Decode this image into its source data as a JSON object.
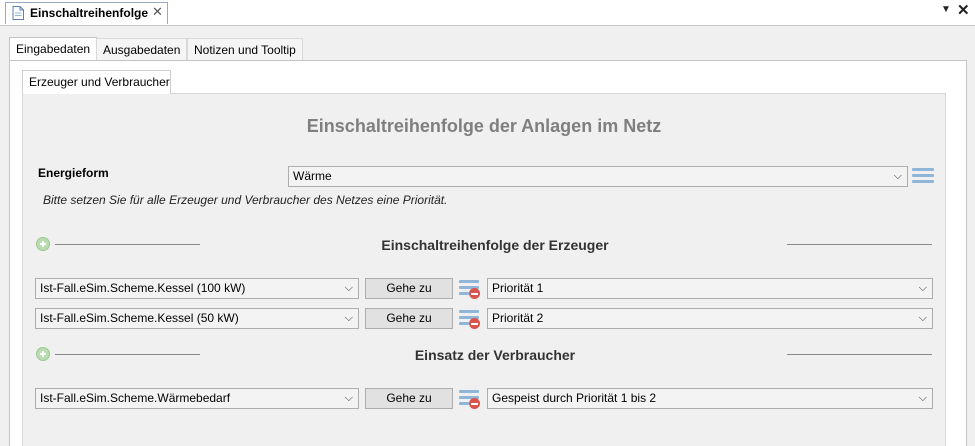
{
  "document_tab": {
    "label": "Einschaltreihenfolge",
    "close": "✕"
  },
  "window": {
    "pin": "▼",
    "close": "✕"
  },
  "tabs": [
    "Eingabedaten",
    "Ausgabedaten",
    "Notizen und Tooltip"
  ],
  "inner_tab": "Erzeuger und Verbraucher",
  "title": "Einschaltreihenfolge der Anlagen im Netz",
  "energy": {
    "label": "Energieform",
    "value": "Wärme"
  },
  "hint": "Bitte setzen Sie für alle Erzeuger und Verbraucher des Netzes eine Priorität.",
  "producers": {
    "title": "Einschaltreihenfolge der Erzeuger",
    "rows": [
      {
        "item": "Ist-Fall.eSim.Scheme.Kessel (100 kW)",
        "button": "Gehe zu",
        "priority": "Priorität 1"
      },
      {
        "item": "Ist-Fall.eSim.Scheme.Kessel (50 kW)",
        "button": "Gehe zu",
        "priority": "Priorität 2"
      }
    ]
  },
  "consumers": {
    "title": "Einsatz der Verbraucher",
    "rows": [
      {
        "item": "Ist-Fall.eSim.Scheme.Wärmebedarf",
        "button": "Gehe zu",
        "priority": "Gespeist durch Priorität 1 bis 2"
      }
    ]
  },
  "colors": {
    "title_gray": "#7f7f7f",
    "panel_bg": "#f0f0f0",
    "add_green": "#b9ddb0",
    "remove_red": "#d9534f",
    "list_blue": "#8fb6d9"
  }
}
